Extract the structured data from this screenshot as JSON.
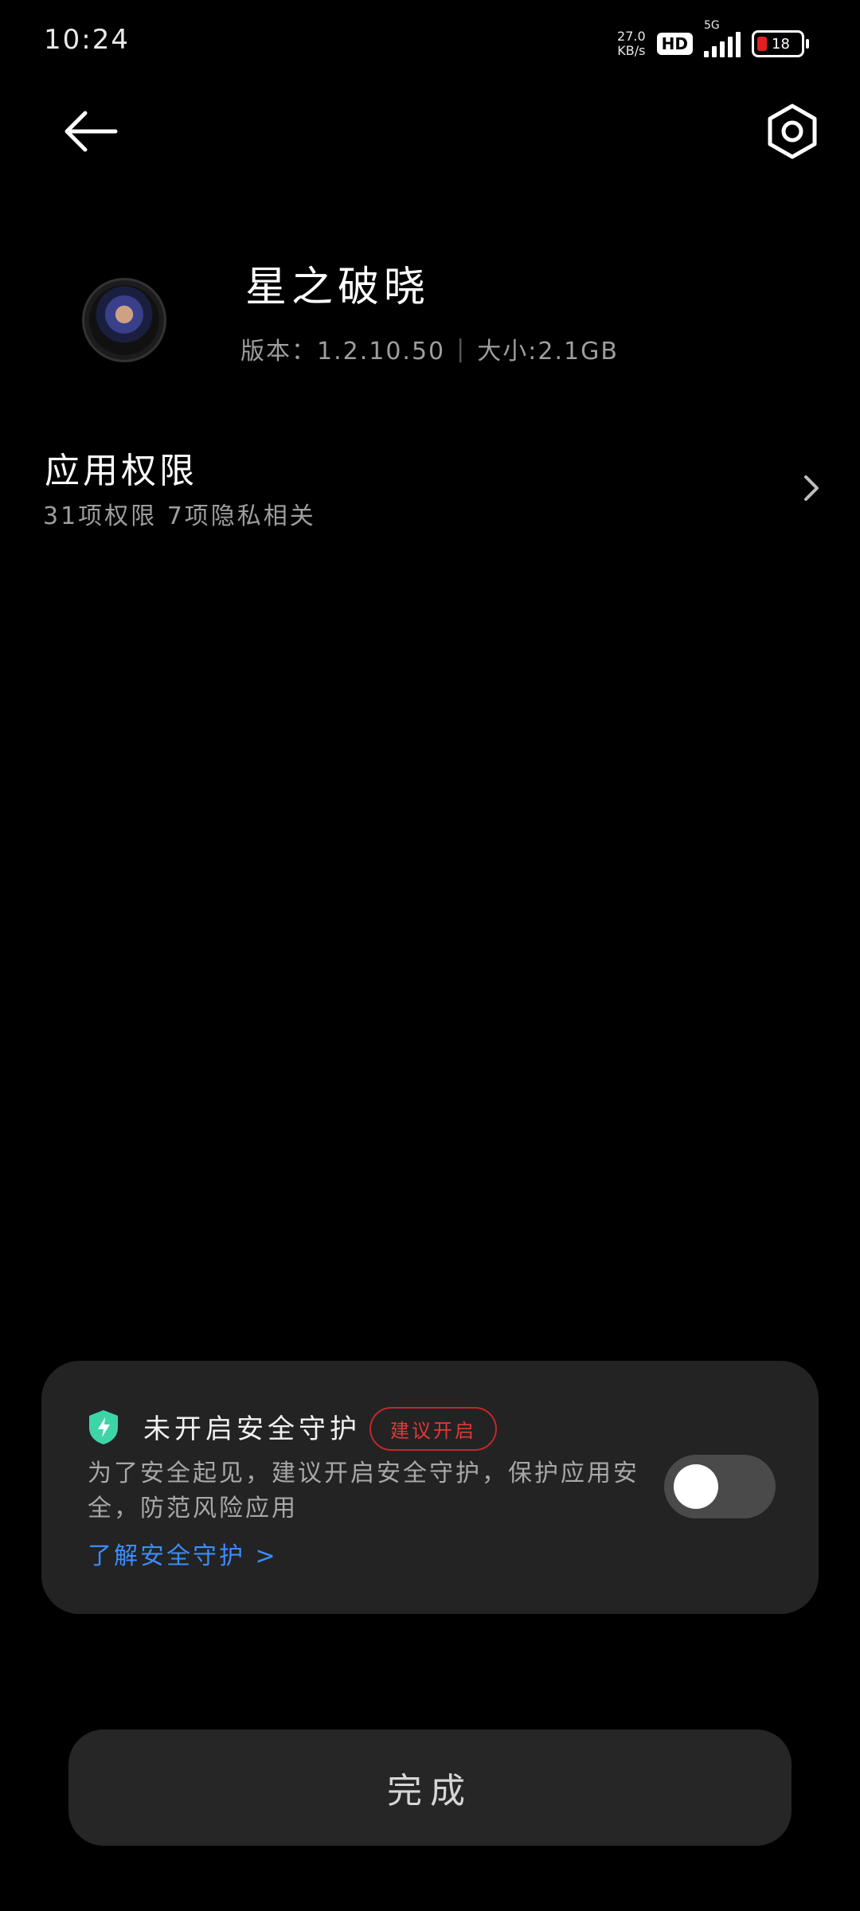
{
  "status_bar": {
    "time": "10:24",
    "net_speed_value": "27.0",
    "net_speed_unit": "KB/s",
    "hd_label": "HD",
    "signal_label": "5G",
    "battery_level": "18"
  },
  "icons": {
    "back": "back-arrow-icon",
    "settings": "settings-icon",
    "shield": "shield-icon",
    "chevron": "chevron-right-icon"
  },
  "app": {
    "name": "星之破晓",
    "version_text": "版本：1.2.10.50",
    "separator": "|",
    "size_text": "大小:2.1GB"
  },
  "permissions": {
    "title": "应用权限",
    "subtitle": "31项权限 7项隐私相关"
  },
  "security_card": {
    "title": "未开启安全守护",
    "badge": "建议开启",
    "description": "为了安全起见，建议开启安全守护，保护应用安全，防范风险应用",
    "link": "了解安全守护 >",
    "toggle_on": false
  },
  "done_button": "完成",
  "colors": {
    "background": "#000000",
    "card": "#232323",
    "accent_link": "#3b8dff",
    "badge_red": "#e0393a",
    "shield_green": "#3fd4a8"
  }
}
